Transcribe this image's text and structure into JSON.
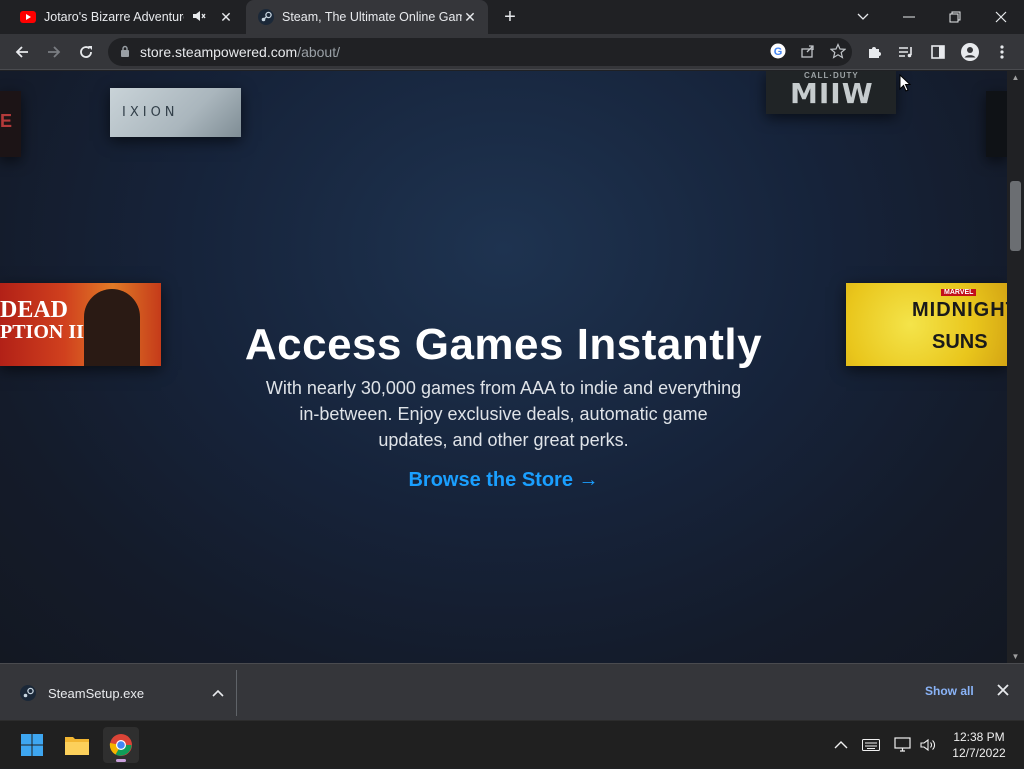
{
  "browser": {
    "tabs": [
      {
        "title": "Jotaro's Bizarre Adventures |",
        "favicon": "youtube-icon",
        "audio": "speaker-muted-icon",
        "active": false
      },
      {
        "title": "Steam, The Ultimate Online Gam",
        "favicon": "steam-icon",
        "active": true
      }
    ],
    "url_host": "store.steampowered.com",
    "url_path": "/about/"
  },
  "page": {
    "tiles": {
      "ixion": "IXION",
      "cod_small": "CALL·DUTY",
      "cod_big": "MIIW",
      "left_edge": "E",
      "rdr_line1": "DEAD",
      "rdr_line2": "PTION II",
      "ms_brand": "MARVEL",
      "ms_line1": "MIDNIGHT",
      "ms_line2": "SUNS"
    },
    "hero": {
      "title": "Access Games Instantly",
      "description": "With nearly 30,000 games from AAA to indie and everything in-between. Enjoy exclusive deals, automatic game updates, and other great perks.",
      "cta": "Browse the Store →"
    },
    "accent_color": "#1a9fff"
  },
  "downloads": {
    "filename": "SteamSetup.exe",
    "show_all": "Show all"
  },
  "taskbar": {
    "time": "12:38 PM",
    "date": "12/7/2022"
  }
}
